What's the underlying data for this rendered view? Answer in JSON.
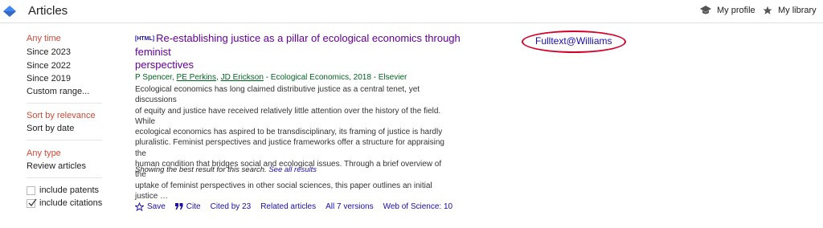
{
  "header": {
    "title": "Articles",
    "my_profile": "My profile",
    "my_library": "My library"
  },
  "sidebar": {
    "time": [
      "Any time",
      "Since 2023",
      "Since 2022",
      "Since 2019",
      "Custom range..."
    ],
    "sort": [
      "Sort by relevance",
      "Sort by date"
    ],
    "type": [
      "Any type",
      "Review articles"
    ],
    "include_patents": "include patents",
    "include_citations": "include citations",
    "include_patents_checked": false,
    "include_citations_checked": true
  },
  "result": {
    "tag": "[HTML]",
    "title_line1": "Re-establishing justice as a pillar of ecological economics through feminist",
    "title_line2": "perspectives",
    "authors": {
      "a1": "P Spencer",
      "a2": "PE Perkins",
      "a3": "JD Erickson",
      "rest": " - Ecological Economics, 2018 - Elsevier"
    },
    "snippet": [
      "Ecological economics has long claimed distributive justice as a central tenet, yet discussions",
      "of equity and justice have received relatively little attention over the history of the field. While",
      "ecological economics has aspired to be transdisciplinary, its framing of justice is hardly",
      "pluralistic. Feminist perspectives and justice frameworks offer a structure for appraising the",
      "human condition that bridges social and ecological issues. Through a brief overview of the",
      "uptake of feminist perspectives in other social sciences, this paper outlines an initial justice …"
    ],
    "actions": {
      "save": "Save",
      "cite": "Cite",
      "cited_by": "Cited by 23",
      "related": "Related articles",
      "versions": "All 7 versions",
      "wos": "Web of Science: 10"
    },
    "fulltext": "Fulltext@Williams"
  },
  "footer": {
    "note": "Showing the best result for this search.",
    "see_all": "See all results"
  },
  "colors": {
    "active_red": "#d14836",
    "link_blue": "#1a0dab",
    "visited_purple": "#660099",
    "meta_green": "#006621",
    "annotation_red": "#d6002a"
  }
}
